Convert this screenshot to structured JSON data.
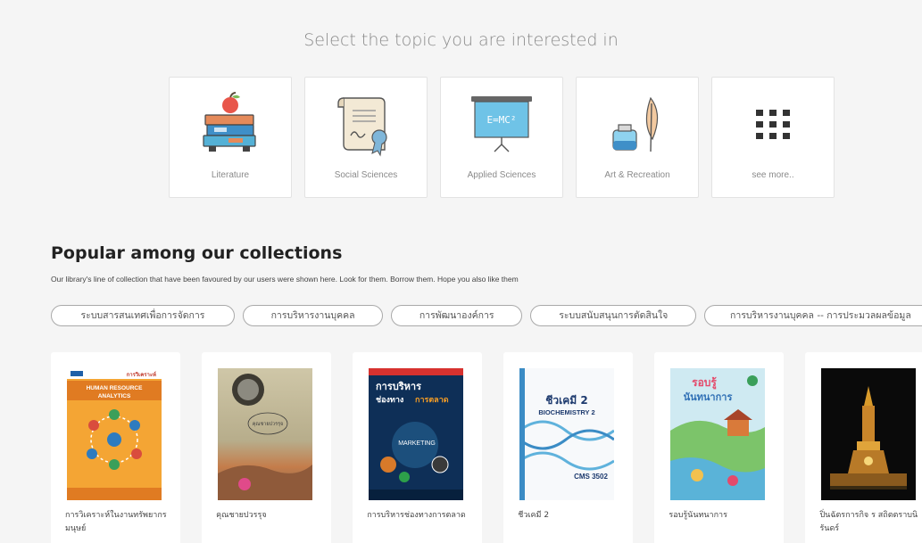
{
  "topics": {
    "heading": "Select the topic you are interested in",
    "items": [
      {
        "label": "Literature",
        "icon": "books-apple-icon"
      },
      {
        "label": "Social Sciences",
        "icon": "certificate-icon"
      },
      {
        "label": "Applied Sciences",
        "icon": "blackboard-icon"
      },
      {
        "label": "Art & Recreation",
        "icon": "ink-quill-icon"
      },
      {
        "label": "see more..",
        "icon": "grid-dots-icon"
      }
    ]
  },
  "popular": {
    "title": "Popular among our collections",
    "subtitle": "Our library's line of collection that have been favoured by our users were shown here. Look for them. Borrow them. Hope you also like them",
    "chips": [
      "ระบบสารสนเทศเพื่อการจัดการ",
      "การบริหารงานบุคคล",
      "การพัฒนาองค์การ",
      "ระบบสนับสนุนการตัดสินใจ",
      "การบริหารงานบุคคล -- การประมวลผลข้อมูล"
    ],
    "books": [
      {
        "title": "การวิเคราะห์ในงานทรัพยากรมนุษย์",
        "cover_text": {
          "a": "การวิเคราะห์",
          "b": "HUMAN RESOURCE",
          "c": "ANALYTICS"
        }
      },
      {
        "title": "คุณชายปวรรุจ",
        "cover_text": {
          "a": "คุณชายปวรรุจ"
        }
      },
      {
        "title": "การบริหารช่องทางการตลาด",
        "cover_text": {
          "a": "การบริหาร",
          "b": "ช่องทาง",
          "c": "การตลาด",
          "d": "MARKETING"
        }
      },
      {
        "title": "ชีวเคมี 2",
        "cover_text": {
          "a": "ชีวเคมี 2",
          "b": "BIOCHEMISTRY 2",
          "c": "CMS 3502"
        }
      },
      {
        "title": "รอบรู้นันทนาการ",
        "cover_text": {
          "a": "รอบรู้",
          "b": "นันทนาการ"
        }
      },
      {
        "title": "ปิ่นฉัตรการกิจ ร สถิตตราบนิรันดร์",
        "cover_text": {}
      }
    ]
  },
  "colors": {
    "page_bg": "#f5f5f5",
    "card_bg": "#ffffff",
    "muted_text": "#8a8a8a",
    "heading_text": "#222222",
    "chip_border": "#a9a9a9"
  }
}
